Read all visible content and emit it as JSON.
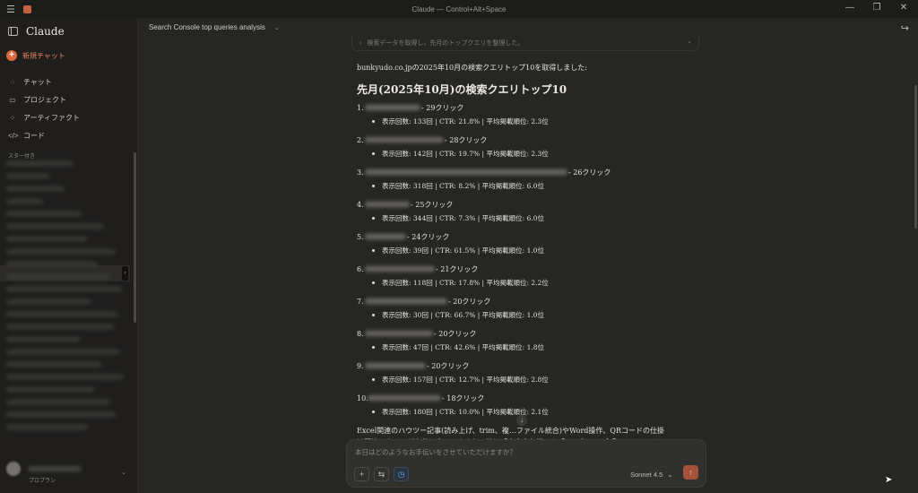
{
  "window": {
    "title": "Claude — Control+Alt+Space",
    "controls": [
      "—",
      "❐",
      "✕"
    ]
  },
  "sidebar": {
    "brand": "Claude",
    "new_chat": "新規チャット",
    "nav": [
      {
        "label": "チャット",
        "icon": "chat-icon"
      },
      {
        "label": "プロジェクト",
        "icon": "folder-icon"
      },
      {
        "label": "アーティファクト",
        "icon": "artifacts-icon"
      },
      {
        "label": "コード",
        "icon": "code-icon"
      }
    ],
    "starred_label": "スター付き",
    "user": {
      "plan": "プロプラン"
    }
  },
  "conversation": {
    "title": "Search Console top queries analysis",
    "collapsed_step": "検索データを取得し、先月のトップクエリを整理した。"
  },
  "response": {
    "intro": "bunkyudo.co.jpの2025年10月の検索クエリトップ10を取得しました:",
    "heading": "先月(2025年10月)の検索クエリトップ10",
    "queries": [
      {
        "num": "1.",
        "clicks": "- 29クリック",
        "stats": "表示回数: 133回 | CTR: 21.8% | 平均掲載順位: 2.3位"
      },
      {
        "num": "2.",
        "clicks": "- 28クリック",
        "stats": "表示回数: 142回 | CTR: 19.7% | 平均掲載順位: 2.3位"
      },
      {
        "num": "3.",
        "clicks": "- 26クリック",
        "stats": "表示回数: 318回 | CTR: 8.2% | 平均掲載順位: 6.0位"
      },
      {
        "num": "4.",
        "clicks": "- 25クリック",
        "stats": "表示回数: 344回 | CTR: 7.3% | 平均掲載順位: 6.0位"
      },
      {
        "num": "5.",
        "clicks": "- 24クリック",
        "stats": "表示回数: 39回 | CTR: 61.5% | 平均掲載順位: 1.0位"
      },
      {
        "num": "6.",
        "clicks": "- 21クリック",
        "stats": "表示回数: 118回 | CTR: 17.8% | 平均掲載順位: 2.2位"
      },
      {
        "num": "7.",
        "clicks": "- 20クリック",
        "stats": "表示回数: 30回 | CTR: 66.7% | 平均掲載順位: 1.0位"
      },
      {
        "num": "8.",
        "clicks": "- 20クリック",
        "stats": "表示回数: 47回 | CTR: 42.6% | 平均掲載順位: 1.8位"
      },
      {
        "num": "9.",
        "clicks": "- 20クリック",
        "stats": "表示回数: 157回 | CTR: 12.7% | 平均掲載順位: 2.8位"
      },
      {
        "num": "10.",
        "clicks": "- 18クリック",
        "stats": "表示回数: 180回 | CTR: 10.0% | 平均掲載順位: 2.1位"
      }
    ],
    "summary_line1": "Excel関連のハウツー記事(読み上げ、trim、複…ファイル統合)やWord操作、QRコードの仕掛",
    "summary_line2": "け関連のクエリが上位に来ていますね。特に「東京文久堂」や「excel trim 全角スペース」は"
  },
  "composer": {
    "placeholder": "本日はどのようなお手伝いをさせていただけますか？",
    "model": "Sonnet 4.5"
  },
  "colors": {
    "background": "#262624",
    "sidebar": "#1f1e1d",
    "accent": "#d9683f",
    "send_button": "#a4523a"
  }
}
